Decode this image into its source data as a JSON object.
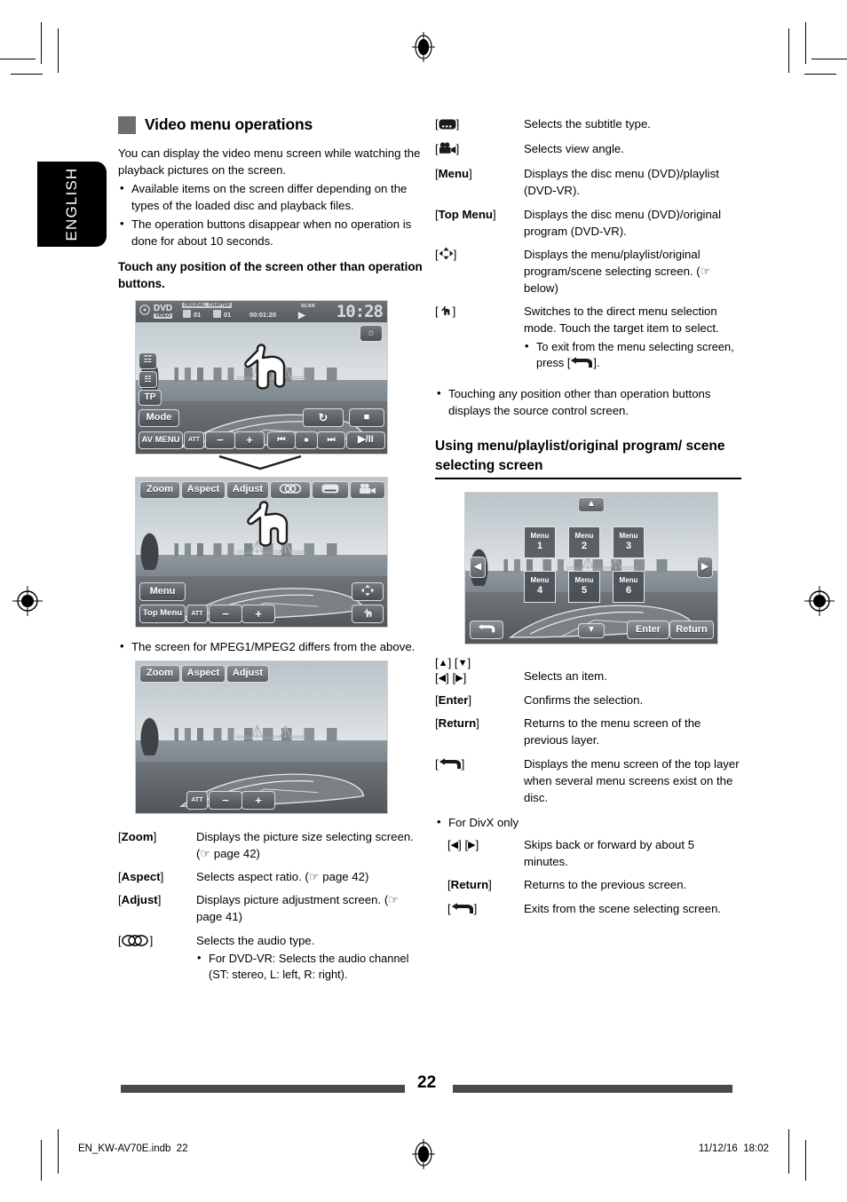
{
  "language_tab": "ENGLISH",
  "left_column": {
    "heading": "Video menu operations",
    "intro": "You can display the video menu screen while watching the playback pictures on the screen.",
    "intro_bullets": [
      "Available items on the screen differ depending on the types of the loaded disc and playback files.",
      "The operation buttons disappear when no operation is done for about 10 seconds."
    ],
    "instruction": "Touch any position of the screen other than operation buttons.",
    "mpeg_note": "The screen for MPEG1/MPEG2 differs from the above.",
    "definitions": [
      {
        "key": "[",
        "key_bold": "Zoom",
        "key_end": "]",
        "desc": "Displays the picture size selecting screen. (☞ page 42)"
      },
      {
        "key": "[",
        "key_bold": "Aspect",
        "key_end": "]",
        "desc": "Selects aspect ratio. (☞ page 42)"
      },
      {
        "key": "[",
        "key_bold": "Adjust",
        "key_end": "]",
        "desc": "Displays picture adjustment screen. (☞ page 41)"
      },
      {
        "key": "[",
        "key_bold": "",
        "key_end": "]",
        "key_icon": "audio-icon",
        "desc": "Selects the audio type.",
        "sub_bullets": [
          "For DVD-VR: Selects the audio channel (ST: stereo, L: left, R: right)."
        ]
      }
    ]
  },
  "right_column": {
    "definitions_top": [
      {
        "key_icon": "subtitle-icon",
        "desc": "Selects the subtitle type."
      },
      {
        "key_icon": "angle-icon",
        "desc": "Selects view angle."
      },
      {
        "key_bold": "Menu",
        "desc": "Displays the disc menu (DVD)/playlist (DVD-VR)."
      },
      {
        "key_bold": "Top Menu",
        "desc": "Displays the disc menu (DVD)/original program (DVD-VR)."
      },
      {
        "key_icon": "dpad-icon",
        "desc": "Displays the menu/playlist/original program/scene selecting screen. (☞ below)"
      },
      {
        "key_icon": "hand-icon",
        "desc": "Switches to the direct menu selection mode. Touch the target item to select.",
        "sub_bullets": [
          "To exit from the menu selecting screen, press [RETURN-ICON]."
        ]
      }
    ],
    "note_bullet": "Touching any position other than operation buttons displays the source control screen.",
    "heading": "Using menu/playlist/original program/ scene selecting screen",
    "definitions_bottom": [
      {
        "key_arrows": "[▲] [▼]\n[◀] [▶]",
        "desc": "Selects an item."
      },
      {
        "key_bold": "Enter",
        "desc": "Confirms the selection."
      },
      {
        "key_bold": "Return",
        "desc": "Returns to the menu screen of the previous layer."
      },
      {
        "key_icon": "return-icon",
        "desc": "Displays the menu screen of the top layer when several menu screens exist on the disc."
      }
    ],
    "divx_note": "For DivX only",
    "definitions_divx": [
      {
        "key_arrows": "[◀] [▶]",
        "desc": "Skips back or forward by about 5 minutes."
      },
      {
        "key_bold": "Return",
        "desc": "Returns to the previous screen."
      },
      {
        "key_icon": "return-icon",
        "desc": "Exits from the scene selecting screen."
      }
    ]
  },
  "screenshot_1": {
    "source": "DVD",
    "source_sub": "VIDEO",
    "badge_original": "ORIGINAL",
    "badge_chapter": "CHAPTER",
    "title_no": "01",
    "chapter_no": "01",
    "elapsed": "00:01:20",
    "scan_label": "SCAN",
    "clock": "10:28",
    "tp": "TP",
    "mode": "Mode",
    "av_menu": "AV MENU",
    "att": "ATT",
    "minus": "−",
    "plus": "+",
    "prev": "⏮",
    "stop_sq": "■",
    "next": "⏭",
    "playpause": "▶/II",
    "repeat": "↻",
    "stop": "■"
  },
  "screenshot_2": {
    "zoom": "Zoom",
    "aspect": "Aspect",
    "adjust": "Adjust",
    "audio_icon": "audio-icon",
    "subtitle_icon": "subtitle-icon",
    "angle_icon": "angle-icon",
    "menu": "Menu",
    "top_menu": "Top Menu",
    "att": "ATT",
    "minus": "−",
    "plus": "+",
    "dpad_icon": "dpad-icon",
    "hand_icon": "hand-icon"
  },
  "screenshot_3": {
    "zoom": "Zoom",
    "aspect": "Aspect",
    "adjust": "Adjust",
    "att": "ATT",
    "minus": "−",
    "plus": "+"
  },
  "screenshot_4": {
    "menus": [
      "Menu\n1",
      "Menu\n2",
      "Menu\n3",
      "Menu\n4",
      "Menu\n5",
      "Menu\n6"
    ],
    "menu_items": [
      {
        "label": "Menu",
        "number": "1"
      },
      {
        "label": "Menu",
        "number": "2"
      },
      {
        "label": "Menu",
        "number": "3"
      },
      {
        "label": "Menu",
        "number": "4"
      },
      {
        "label": "Menu",
        "number": "5"
      },
      {
        "label": "Menu",
        "number": "6"
      }
    ],
    "up": "▲",
    "down": "▼",
    "left": "◀",
    "right": "▶",
    "enter": "Enter",
    "return": "Return",
    "back_icon": "return-icon"
  },
  "footer": {
    "page_number": "22",
    "file_name": "EN_KW-AV70E.indb",
    "file_page": "22",
    "date": "11/12/16",
    "time": "18:02"
  },
  "colors": {
    "heading_square": "#6e6e6e",
    "rule": "#4a4a4a",
    "tab_bg": "#000000"
  }
}
